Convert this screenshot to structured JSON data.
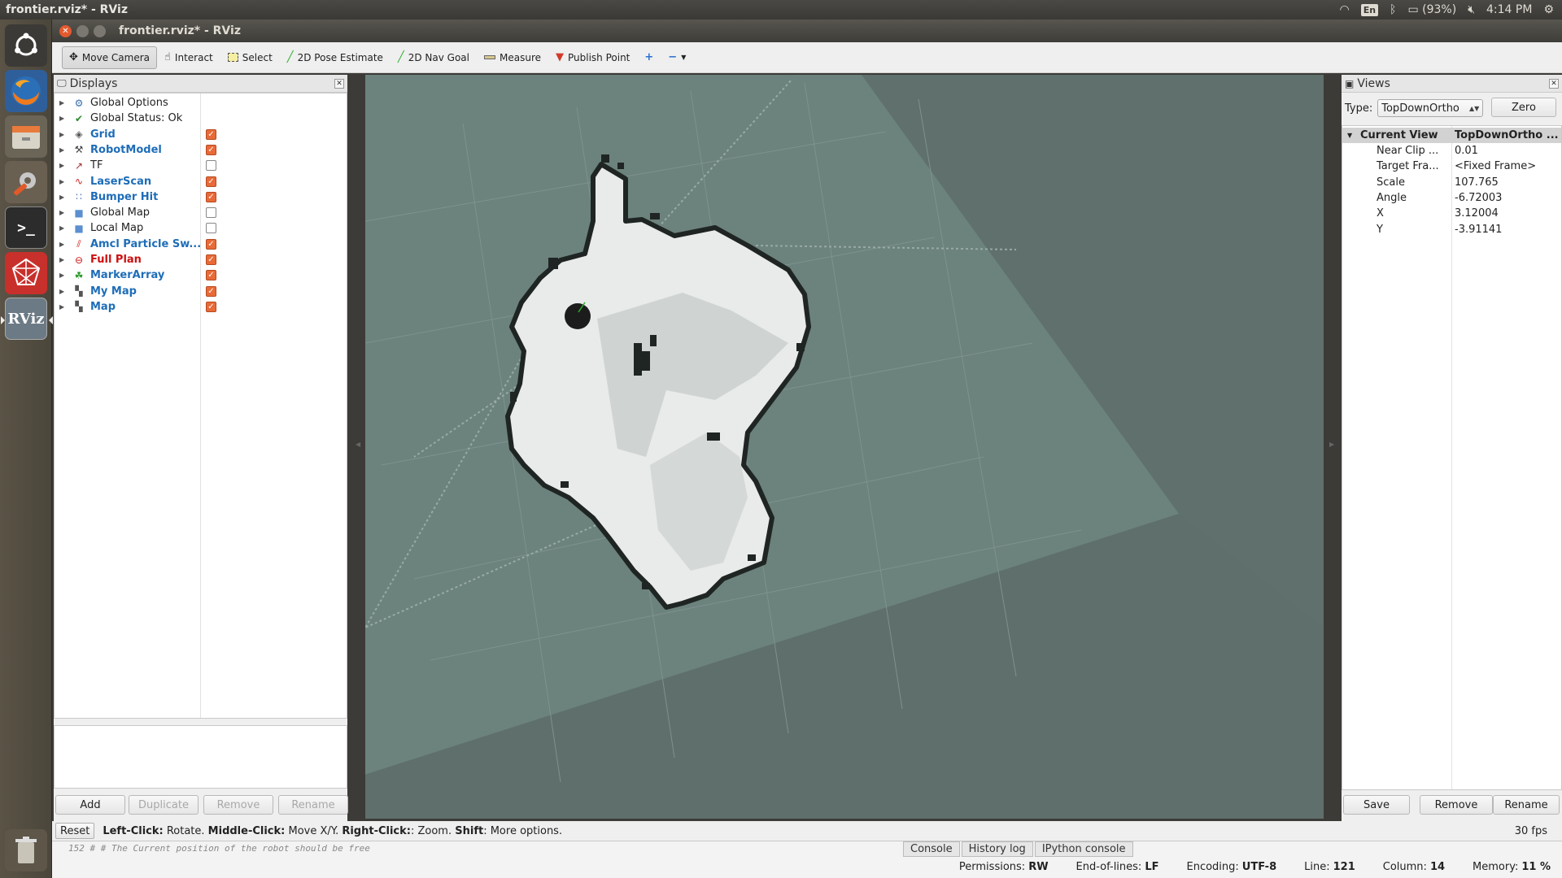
{
  "top_panel": {
    "app_title": "frontier.rviz* - RViz",
    "keyboard": "En",
    "battery": "(93%)",
    "time": "4:14 PM"
  },
  "launcher": {
    "items": [
      "ubuntu-home",
      "firefox",
      "files",
      "settings",
      "terminal",
      "rviz-alt",
      "RViz",
      "trash"
    ],
    "rviz_label": "RViz"
  },
  "window": {
    "title": "frontier.rviz* - RViz"
  },
  "toolbar": {
    "move_camera": "Move Camera",
    "interact": "Interact",
    "select": "Select",
    "pose_estimate": "2D Pose Estimate",
    "nav_goal": "2D Nav Goal",
    "measure": "Measure",
    "publish_point": "Publish Point"
  },
  "displays": {
    "title": "Displays",
    "items": [
      {
        "label": "Global Options",
        "style": "normal",
        "checkbox": null,
        "icon": "gear-icon"
      },
      {
        "label": "Global Status: Ok",
        "style": "normal",
        "checkbox": null,
        "icon": "check-icon"
      },
      {
        "label": "Grid",
        "style": "blue",
        "checkbox": true,
        "icon": "grid-icon"
      },
      {
        "label": "RobotModel",
        "style": "blue",
        "checkbox": true,
        "icon": "robot-icon"
      },
      {
        "label": "TF",
        "style": "normal",
        "checkbox": false,
        "icon": "tf-icon"
      },
      {
        "label": "LaserScan",
        "style": "blue",
        "checkbox": true,
        "icon": "laser-icon"
      },
      {
        "label": "Bumper Hit",
        "style": "blue",
        "checkbox": true,
        "icon": "points-icon"
      },
      {
        "label": "Global Map",
        "style": "normal",
        "checkbox": false,
        "icon": "folder-icon"
      },
      {
        "label": "Local Map",
        "style": "normal",
        "checkbox": false,
        "icon": "folder-icon"
      },
      {
        "label": "Amcl Particle Sw...",
        "style": "blue",
        "checkbox": true,
        "icon": "pose-array-icon"
      },
      {
        "label": "Full Plan",
        "style": "red",
        "checkbox": true,
        "icon": "error-icon"
      },
      {
        "label": "MarkerArray",
        "style": "blue",
        "checkbox": true,
        "icon": "marker-icon"
      },
      {
        "label": "My Map",
        "style": "blue",
        "checkbox": true,
        "icon": "map-icon"
      },
      {
        "label": "Map",
        "style": "blue",
        "checkbox": true,
        "icon": "map-icon"
      }
    ],
    "buttons": {
      "add": "Add",
      "duplicate": "Duplicate",
      "remove": "Remove",
      "rename": "Rename"
    }
  },
  "views": {
    "title": "Views",
    "type_label": "Type:",
    "type_value": "TopDownOrtho",
    "zero": "Zero",
    "current_view": {
      "key": "Current View",
      "value": "TopDownOrtho ..."
    },
    "properties": [
      {
        "key": "Near Clip ...",
        "value": "0.01"
      },
      {
        "key": "Target Fra...",
        "value": "<Fixed Frame>"
      },
      {
        "key": "Scale",
        "value": "107.765"
      },
      {
        "key": "Angle",
        "value": "-6.72003"
      },
      {
        "key": "X",
        "value": "3.12004"
      },
      {
        "key": "Y",
        "value": "-3.91141"
      }
    ],
    "buttons": {
      "save": "Save",
      "remove": "Remove",
      "rename": "Rename"
    }
  },
  "statusbar": {
    "reset": "Reset",
    "help_left_b": "Left-Click:",
    "help_left": " Rotate. ",
    "help_middle_b": "Middle-Click:",
    "help_middle": " Move X/Y. ",
    "help_right_b": "Right-Click:",
    "help_right": ": Zoom. ",
    "help_shift_b": "Shift",
    "help_shift": ": More options.",
    "fps": "30 fps"
  },
  "editor": {
    "code_line": "152 #        # The Current position of the robot should be free",
    "tabs": [
      "Console",
      "History log",
      "IPython console"
    ],
    "permissions_label": "Permissions:",
    "permissions": "RW",
    "eol_label": "End-of-lines:",
    "eol": "LF",
    "encoding_label": "Encoding:",
    "encoding": "UTF-8",
    "line_label": "Line:",
    "line": "121",
    "column_label": "Column:",
    "column": "14",
    "memory_label": "Memory:",
    "memory": "11 %"
  },
  "colors": {
    "viewport_bg": "#5f706d",
    "map_floor": "#6f8580",
    "free_space": "#eaeaea",
    "walls": "#1e2422",
    "robot": "#1a1a1a",
    "checkbox_on": "#e86a38"
  }
}
